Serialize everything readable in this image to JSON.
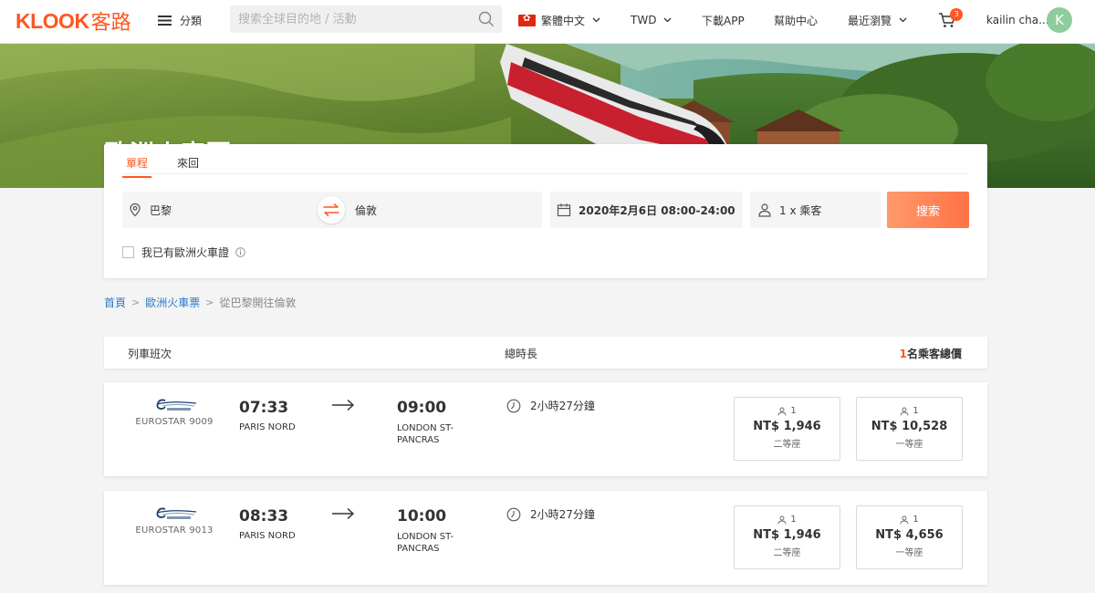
{
  "nav": {
    "logo_text": "KLOOK",
    "logo_cn": "客路",
    "menu_label": "分類",
    "search_placeholder": "搜索全球目的地 / 活動",
    "language": "繁體中文",
    "currency": "TWD",
    "download": "下載APP",
    "help": "幫助中心",
    "recent": "最近瀏覽",
    "cart_count": "3",
    "user_name": "kailin cha...",
    "avatar_letter": "K"
  },
  "hero": {
    "title": "歐洲火車票"
  },
  "search": {
    "tabs": [
      "單程",
      "來回"
    ],
    "active_tab": "單程",
    "from": "巴黎",
    "to": "倫敦",
    "date": "2020年2月6日 08:00-24:00",
    "passengers": "1 x 乘客",
    "button": "搜索",
    "rail_pass_label": "我已有歐洲火車證"
  },
  "breadcrumb": {
    "home": "首頁",
    "category": "歐洲火車票",
    "current": "從巴黎開往倫敦"
  },
  "table": {
    "col_train": "列車班次",
    "col_duration": "總時長",
    "col_price_num": "1",
    "col_price_suffix": "名乘客總價"
  },
  "trains": [
    {
      "name": "EUROSTAR 9009",
      "dep_time": "07:33",
      "dep_station": "PARIS NORD",
      "arr_time": "09:00",
      "arr_station": "LONDON ST-PANCRAS",
      "duration": "2小時27分鐘",
      "fares": [
        {
          "pax": "1",
          "price": "NT$ 1,946",
          "class": "二等座"
        },
        {
          "pax": "1",
          "price": "NT$ 10,528",
          "class": "一等座"
        }
      ]
    },
    {
      "name": "EUROSTAR 9013",
      "dep_time": "08:33",
      "dep_station": "PARIS NORD",
      "arr_time": "10:00",
      "arr_station": "LONDON ST-PANCRAS",
      "duration": "2小時27分鐘",
      "fares": [
        {
          "pax": "1",
          "price": "NT$ 1,946",
          "class": "二等座"
        },
        {
          "pax": "1",
          "price": "NT$ 4,656",
          "class": "一等座"
        }
      ]
    }
  ],
  "colors": {
    "accent": "#ff5722",
    "link": "#2a7ac9"
  }
}
